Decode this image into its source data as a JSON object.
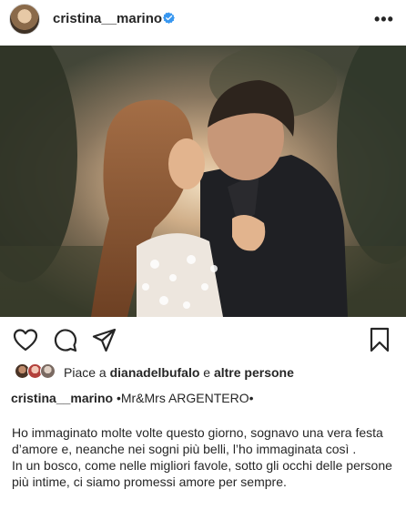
{
  "header": {
    "username": "cristina__marino",
    "verified": true,
    "more_label": "•••"
  },
  "post": {
    "image_alt": "Wedding couple kissing at sunset in a forest",
    "image_icon": "wedding-photo"
  },
  "actions": {
    "like_icon": "heart-icon",
    "comment_icon": "comment-icon",
    "share_icon": "send-icon",
    "save_icon": "bookmark-icon"
  },
  "likes": {
    "prefix": "Piace a",
    "user": "dianadelbufalo",
    "connector": "e",
    "others": "altre persone"
  },
  "caption": {
    "username": "cristina__marino",
    "title": "•Mr&Mrs ARGENTERO•",
    "paragraph1": "Ho immaginato molte volte questo giorno, sognavo una vera festa d’amore e, neanche nei sogni più belli, l’ho immaginata così .",
    "paragraph2": "In un bosco, come nelle migliori favole, sotto gli occhi delle persone più intime, ci siamo promessi amore per sempre."
  },
  "colors": {
    "text": "#262626",
    "verified_blue": "#3897f0"
  }
}
